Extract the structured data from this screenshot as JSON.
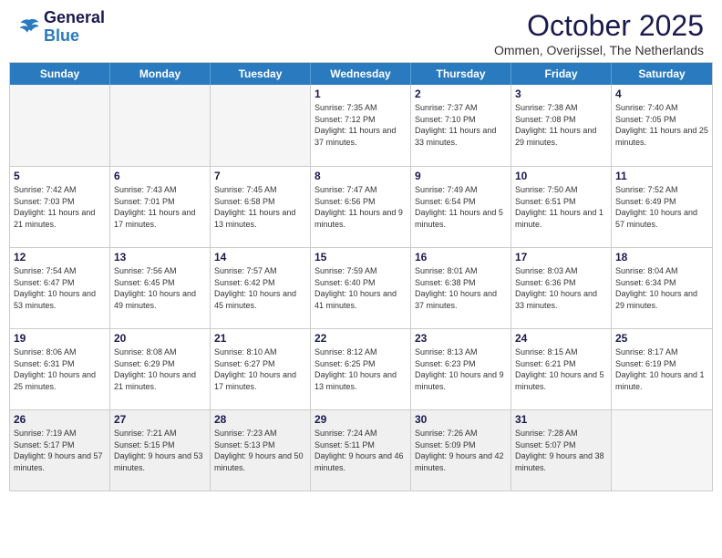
{
  "header": {
    "logo_line1": "General",
    "logo_line2": "Blue",
    "month_title": "October 2025",
    "location": "Ommen, Overijssel, The Netherlands"
  },
  "weekdays": [
    "Sunday",
    "Monday",
    "Tuesday",
    "Wednesday",
    "Thursday",
    "Friday",
    "Saturday"
  ],
  "weeks": [
    [
      {
        "day": "",
        "empty": true
      },
      {
        "day": "",
        "empty": true
      },
      {
        "day": "",
        "empty": true
      },
      {
        "day": "1",
        "sunrise": "7:35 AM",
        "sunset": "7:12 PM",
        "daylight": "11 hours and 37 minutes."
      },
      {
        "day": "2",
        "sunrise": "7:37 AM",
        "sunset": "7:10 PM",
        "daylight": "11 hours and 33 minutes."
      },
      {
        "day": "3",
        "sunrise": "7:38 AM",
        "sunset": "7:08 PM",
        "daylight": "11 hours and 29 minutes."
      },
      {
        "day": "4",
        "sunrise": "7:40 AM",
        "sunset": "7:05 PM",
        "daylight": "11 hours and 25 minutes."
      }
    ],
    [
      {
        "day": "5",
        "sunrise": "7:42 AM",
        "sunset": "7:03 PM",
        "daylight": "11 hours and 21 minutes."
      },
      {
        "day": "6",
        "sunrise": "7:43 AM",
        "sunset": "7:01 PM",
        "daylight": "11 hours and 17 minutes."
      },
      {
        "day": "7",
        "sunrise": "7:45 AM",
        "sunset": "6:58 PM",
        "daylight": "11 hours and 13 minutes."
      },
      {
        "day": "8",
        "sunrise": "7:47 AM",
        "sunset": "6:56 PM",
        "daylight": "11 hours and 9 minutes."
      },
      {
        "day": "9",
        "sunrise": "7:49 AM",
        "sunset": "6:54 PM",
        "daylight": "11 hours and 5 minutes."
      },
      {
        "day": "10",
        "sunrise": "7:50 AM",
        "sunset": "6:51 PM",
        "daylight": "11 hours and 1 minute."
      },
      {
        "day": "11",
        "sunrise": "7:52 AM",
        "sunset": "6:49 PM",
        "daylight": "10 hours and 57 minutes."
      }
    ],
    [
      {
        "day": "12",
        "sunrise": "7:54 AM",
        "sunset": "6:47 PM",
        "daylight": "10 hours and 53 minutes."
      },
      {
        "day": "13",
        "sunrise": "7:56 AM",
        "sunset": "6:45 PM",
        "daylight": "10 hours and 49 minutes."
      },
      {
        "day": "14",
        "sunrise": "7:57 AM",
        "sunset": "6:42 PM",
        "daylight": "10 hours and 45 minutes."
      },
      {
        "day": "15",
        "sunrise": "7:59 AM",
        "sunset": "6:40 PM",
        "daylight": "10 hours and 41 minutes."
      },
      {
        "day": "16",
        "sunrise": "8:01 AM",
        "sunset": "6:38 PM",
        "daylight": "10 hours and 37 minutes."
      },
      {
        "day": "17",
        "sunrise": "8:03 AM",
        "sunset": "6:36 PM",
        "daylight": "10 hours and 33 minutes."
      },
      {
        "day": "18",
        "sunrise": "8:04 AM",
        "sunset": "6:34 PM",
        "daylight": "10 hours and 29 minutes."
      }
    ],
    [
      {
        "day": "19",
        "sunrise": "8:06 AM",
        "sunset": "6:31 PM",
        "daylight": "10 hours and 25 minutes."
      },
      {
        "day": "20",
        "sunrise": "8:08 AM",
        "sunset": "6:29 PM",
        "daylight": "10 hours and 21 minutes."
      },
      {
        "day": "21",
        "sunrise": "8:10 AM",
        "sunset": "6:27 PM",
        "daylight": "10 hours and 17 minutes."
      },
      {
        "day": "22",
        "sunrise": "8:12 AM",
        "sunset": "6:25 PM",
        "daylight": "10 hours and 13 minutes."
      },
      {
        "day": "23",
        "sunrise": "8:13 AM",
        "sunset": "6:23 PM",
        "daylight": "10 hours and 9 minutes."
      },
      {
        "day": "24",
        "sunrise": "8:15 AM",
        "sunset": "6:21 PM",
        "daylight": "10 hours and 5 minutes."
      },
      {
        "day": "25",
        "sunrise": "8:17 AM",
        "sunset": "6:19 PM",
        "daylight": "10 hours and 1 minute."
      }
    ],
    [
      {
        "day": "26",
        "sunrise": "7:19 AM",
        "sunset": "5:17 PM",
        "daylight": "9 hours and 57 minutes."
      },
      {
        "day": "27",
        "sunrise": "7:21 AM",
        "sunset": "5:15 PM",
        "daylight": "9 hours and 53 minutes."
      },
      {
        "day": "28",
        "sunrise": "7:23 AM",
        "sunset": "5:13 PM",
        "daylight": "9 hours and 50 minutes."
      },
      {
        "day": "29",
        "sunrise": "7:24 AM",
        "sunset": "5:11 PM",
        "daylight": "9 hours and 46 minutes."
      },
      {
        "day": "30",
        "sunrise": "7:26 AM",
        "sunset": "5:09 PM",
        "daylight": "9 hours and 42 minutes."
      },
      {
        "day": "31",
        "sunrise": "7:28 AM",
        "sunset": "5:07 PM",
        "daylight": "9 hours and 38 minutes."
      },
      {
        "day": "",
        "empty": true
      }
    ]
  ]
}
